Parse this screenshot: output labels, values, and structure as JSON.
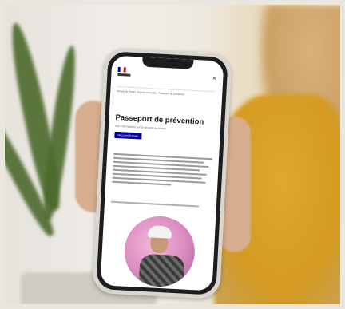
{
  "phone_screen": {
    "subnav": "Accueil du Portail · Espace particulier · Passeport de prévention",
    "close_icon": "close-icon",
    "title": "Passeport de prévention",
    "tagline": "Vos informations sur la sécurité au travail",
    "cta_label": "Découvrir le projet"
  },
  "colors": {
    "sweater": "#d49a22",
    "cta": "#000091",
    "circle": "#d98bc0"
  }
}
